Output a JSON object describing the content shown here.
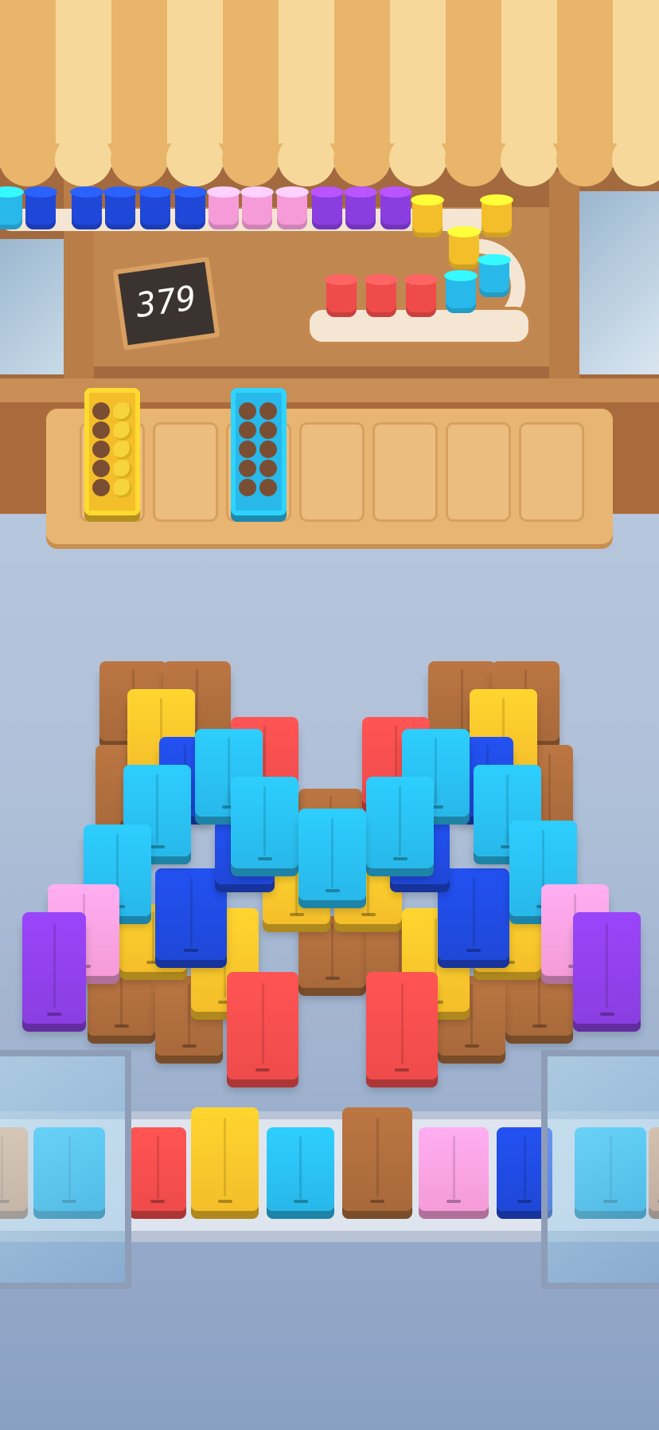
{
  "hud": {
    "score": "379"
  },
  "colors": {
    "brown": "#a8693b",
    "yellow": "#f4be2a",
    "red": "#ef4b4b",
    "cyan": "#28b8ea",
    "blue": "#1f48d8",
    "pink": "#f59bd8",
    "purple": "#8a3ee0",
    "peach": "#e6a374"
  },
  "cups_top_row": [
    "cyan",
    "blue",
    "blue",
    "blue",
    "blue",
    "blue",
    "pink",
    "pink",
    "pink",
    "purple",
    "purple",
    "purple",
    "yellow",
    "yellow",
    "yellow"
  ],
  "cups_lower_row": [
    "red",
    "red",
    "red",
    "cyan",
    "cyan"
  ],
  "crate_tray": {
    "slots_total": 7,
    "crates": [
      {
        "slot": 1,
        "color": "yellow",
        "eggs_filled": 5,
        "capacity": 10
      },
      {
        "slot": 3,
        "color": "cyan",
        "eggs_filled": 0,
        "capacity": 10
      }
    ]
  },
  "board": {
    "block_count": 52
  },
  "conveyor": {
    "blocks": [
      "peach",
      "cyan",
      "red",
      "yellow",
      "cyan",
      "brown",
      "pink",
      "blue",
      "cyan",
      "peach"
    ]
  }
}
